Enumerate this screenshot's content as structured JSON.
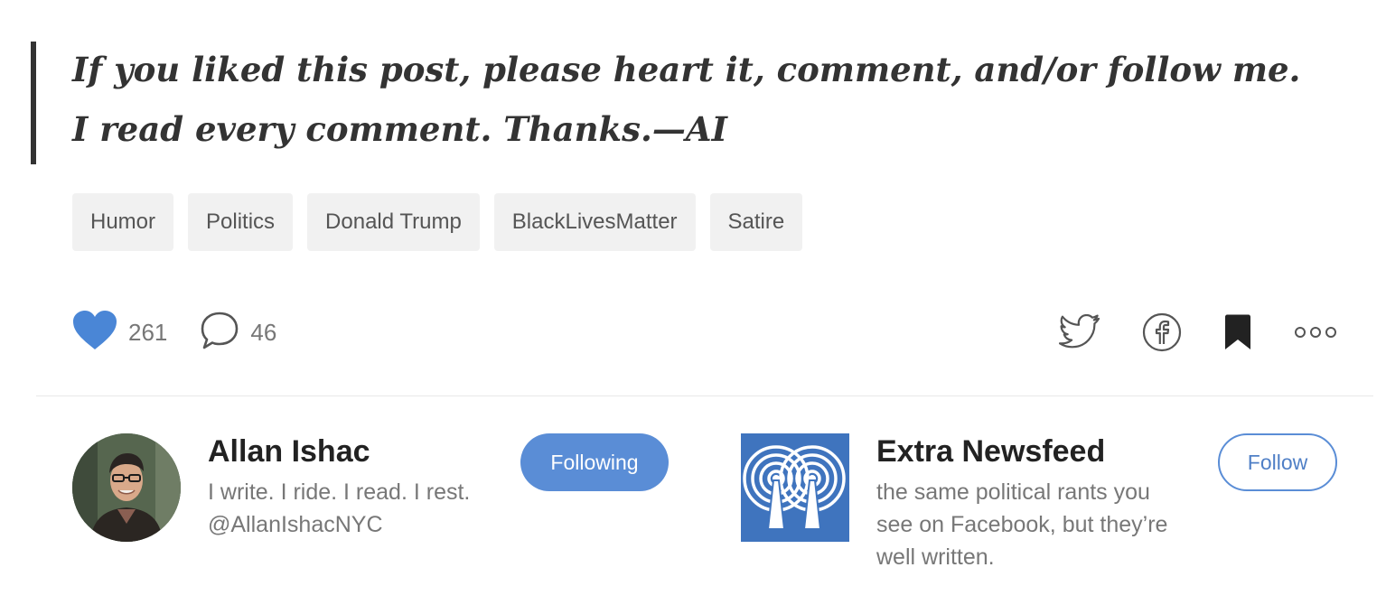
{
  "post": {
    "footer_note": "If you liked this post, please heart it, comment, and/or follow me. I read every comment. Thanks.—AI"
  },
  "tags": [
    "Humor",
    "Politics",
    "Donald Trump",
    "BlackLivesMatter",
    "Satire"
  ],
  "actions": {
    "heart_count": "261",
    "comment_count": "46",
    "heart_color": "#4a86d6",
    "share_icons": [
      "twitter-icon",
      "facebook-icon",
      "bookmark-icon",
      "more-icon"
    ]
  },
  "author": {
    "name": "Allan Ishac",
    "bio": "I write. I ride. I read. I rest. @AllanIshacNYC",
    "follow_state_label": "Following"
  },
  "publication": {
    "name": "Extra Newsfeed",
    "description": "the same political rants you see on Facebook, but they’re well written.",
    "follow_label": "Follow",
    "logo_color": "#3f74be"
  }
}
